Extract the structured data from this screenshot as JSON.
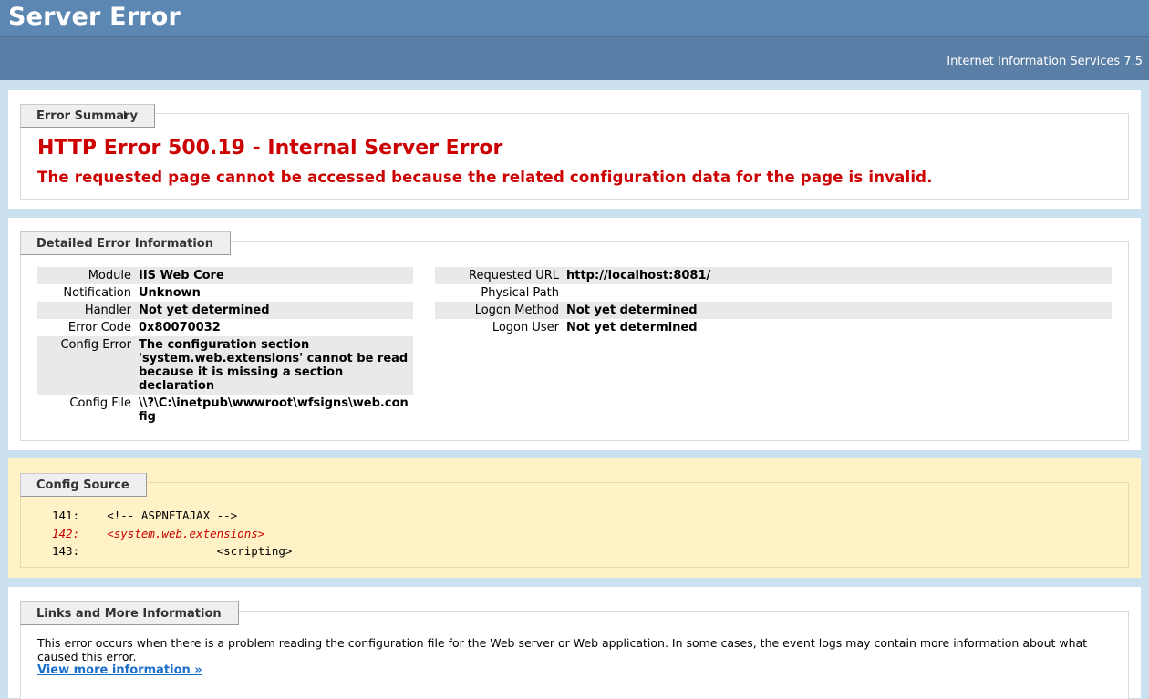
{
  "header": {
    "title": "Server Error",
    "product": "Internet Information Services 7.5"
  },
  "summary": {
    "tab": "Error Summary",
    "title": "HTTP Error 500.19 - Internal Server Error",
    "message": "The requested page cannot be accessed because the related configuration data for the page is invalid."
  },
  "details": {
    "tab": "Detailed Error Information",
    "left": [
      {
        "label": "Module",
        "value": "IIS Web Core"
      },
      {
        "label": "Notification",
        "value": "Unknown"
      },
      {
        "label": "Handler",
        "value": "Not yet determined"
      },
      {
        "label": "Error Code",
        "value": "0x80070032"
      },
      {
        "label": "Config Error",
        "value": "The configuration section 'system.web.extensions' cannot be read because it is missing a section declaration"
      },
      {
        "label": "Config File",
        "value": "\\\\?\\C:\\inetpub\\wwwroot\\wfsigns\\web.config"
      }
    ],
    "right": [
      {
        "label": "Requested URL",
        "value": "http://localhost:8081/"
      },
      {
        "label": "Physical Path",
        "value": ""
      },
      {
        "label": "Logon Method",
        "value": "Not yet determined"
      },
      {
        "label": "Logon User",
        "value": "Not yet determined"
      }
    ]
  },
  "config_source": {
    "tab": "Config Source",
    "lines": [
      {
        "num": "141:",
        "code": "<!-- ASPNETAJAX -->"
      },
      {
        "num": "142:",
        "code": "<system.web.extensions>"
      },
      {
        "num": "143:",
        "code": "\t<scripting>"
      }
    ]
  },
  "links": {
    "tab": "Links and More Information",
    "text": "This error occurs when there is a problem reading the configuration file for the Web server or Web application. In some cases, the event logs may contain more information about what caused this error.",
    "link": "View more information »"
  }
}
